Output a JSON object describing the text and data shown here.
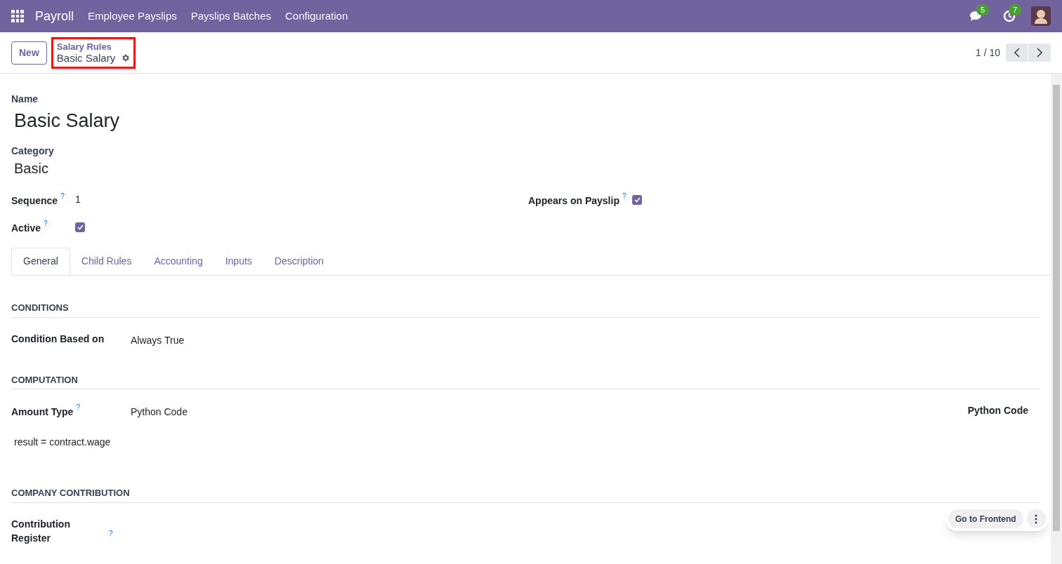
{
  "navbar": {
    "app_name": "Payroll",
    "menu": [
      "Employee Payslips",
      "Payslips Batches",
      "Configuration"
    ],
    "messages_count": "5",
    "activities_count": "7"
  },
  "control_panel": {
    "new_button": "New",
    "breadcrumb_parent": "Salary Rules",
    "breadcrumb_current": "Basic Salary",
    "highlighted": true,
    "pager": "1 / 10"
  },
  "form": {
    "name_label": "Name",
    "name": "Basic Salary",
    "category_label": "Category",
    "category": "Basic",
    "left_fields": [
      {
        "kind": "text",
        "label": "Sequence",
        "help": "?",
        "value": "1"
      },
      {
        "kind": "checkbox",
        "label": "Active",
        "help": "?",
        "checked": true
      }
    ],
    "right_fields": [
      {
        "kind": "checkbox",
        "label": "Appears on Payslip",
        "help": "?",
        "checked": true
      }
    ]
  },
  "tabs": [
    {
      "label": "General",
      "selected": true
    },
    {
      "label": "Child Rules",
      "selected": false
    },
    {
      "label": "Accounting",
      "selected": false
    },
    {
      "label": "Inputs",
      "selected": false
    },
    {
      "label": "Description",
      "selected": false
    }
  ],
  "sections": [
    {
      "title": "CONDITIONS",
      "fields": [
        {
          "label": "Condition Based on",
          "value": "Always True"
        }
      ]
    },
    {
      "title": "COMPUTATION",
      "fields": [
        {
          "label": "Amount Type",
          "help": "?",
          "value": "Python Code"
        }
      ],
      "right_label": "Python Code",
      "code": "result = contract.wage"
    },
    {
      "title": "COMPANY CONTRIBUTION",
      "fields": [
        {
          "label": "Contribution Register",
          "help": "?"
        }
      ]
    }
  ],
  "floating": {
    "button": "Go to Frontend"
  }
}
